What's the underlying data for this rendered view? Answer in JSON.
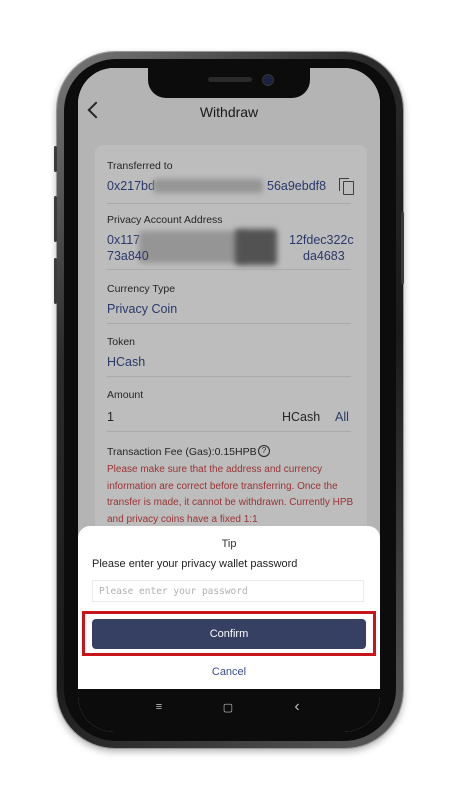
{
  "header": {
    "title": "Withdraw"
  },
  "fields": {
    "transferred_to": {
      "label": "Transferred to",
      "value": "0x217bd",
      "value_tail": "56a9ebdf8"
    },
    "privacy_address": {
      "label": "Privacy Account Address",
      "line1_start": "0x117",
      "line1_end": "12fdec322c",
      "line2_start": "73a840",
      "line2_end": "da4683"
    },
    "currency_type": {
      "label": "Currency Type",
      "value": "Privacy Coin"
    },
    "token": {
      "label": "Token",
      "value": "HCash"
    },
    "amount": {
      "label": "Amount",
      "value": "1",
      "unit": "HCash",
      "all_label": "All"
    }
  },
  "fee": {
    "label": "Transaction Fee (Gas):0.15HPB",
    "help_icon": "?"
  },
  "warning": "Please make sure that the address and currency information are correct before transferring. Once the transfer is made, it cannot be withdrawn. Currently HPB and privacy coins have a fixed 1:1",
  "modal": {
    "title": "Tip",
    "prompt": "Please enter your privacy wallet password",
    "password_placeholder": "Please enter your password",
    "password_value": "",
    "confirm_label": "Confirm",
    "cancel_label": "Cancel"
  },
  "nav": {
    "menu": "≡",
    "home": "▢",
    "back": "‹"
  },
  "colors": {
    "accent": "#354063",
    "link": "#3a4d8f",
    "warning": "#d04848",
    "highlight": "#c8151b"
  }
}
